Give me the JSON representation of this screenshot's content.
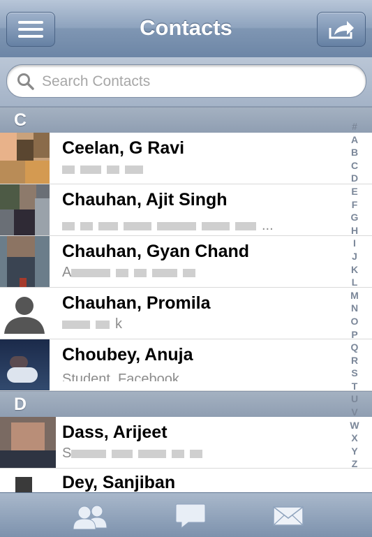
{
  "nav": {
    "title": "Contacts",
    "menu_icon": "menu-icon",
    "share_icon": "share-icon"
  },
  "search": {
    "placeholder": "Search Contacts",
    "icon": "search-icon"
  },
  "sections": [
    {
      "letter": "C",
      "contacts": [
        {
          "name": "Ceelan, G Ravi",
          "detail": ""
        },
        {
          "name": "Chauhan, Ajit Singh",
          "detail": "..."
        },
        {
          "name": "Chauhan, Gyan Chand",
          "detail": "A"
        },
        {
          "name": "Chauhan, Promila",
          "detail": "k"
        },
        {
          "name": "Choubey, Anuja",
          "detail": "Student, Facebook"
        }
      ]
    },
    {
      "letter": "D",
      "contacts": [
        {
          "name": "Dass, Arijeet",
          "detail": "S"
        },
        {
          "name": "Dey, Sanjiban",
          "detail": ""
        }
      ]
    }
  ],
  "index_letters": [
    "#",
    "A",
    "B",
    "C",
    "D",
    "E",
    "F",
    "G",
    "H",
    "I",
    "J",
    "K",
    "L",
    "M",
    "N",
    "O",
    "P",
    "Q",
    "R",
    "S",
    "T",
    "U",
    "V",
    "W",
    "X",
    "Y",
    "Z"
  ],
  "tabs": [
    {
      "name": "contacts",
      "icon": "people-icon"
    },
    {
      "name": "messages",
      "icon": "chat-bubble-icon"
    },
    {
      "name": "mail",
      "icon": "envelope-icon"
    }
  ],
  "colors": {
    "bar": "#7f96b3",
    "section": "#9aa8ba",
    "index": "#7b8799"
  }
}
